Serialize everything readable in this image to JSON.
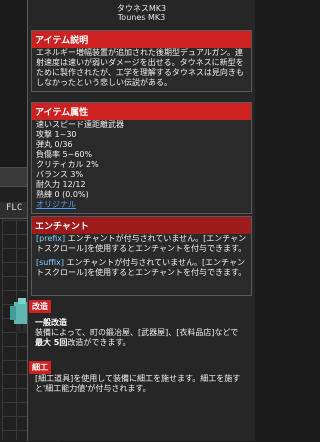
{
  "header": {
    "name_jp": "タウネスMK3",
    "name_en": "Tounes MK3"
  },
  "sections": {
    "description": {
      "title": "アイテム説明",
      "text": "エネルギー増幅装置が追加された後期型デュアルガン。連射速度は速いが弱いダメージを出せる。タウネスに新型をために製作されたが、工学を理解するタウネスは見向きもしなかったという悲しい伝説がある。"
    },
    "attributes": {
      "title": "アイテム属性",
      "rows": [
        "速いスピード遠距離武器",
        "攻撃 1~30",
        "弾丸 0/36",
        "負傷率 5~60%",
        "クリティカル 2%",
        "バランス 3%",
        "耐久力 12/12",
        "熟練 0 (0.0%)"
      ],
      "original": "オリジナル"
    },
    "enchant": {
      "title": "エンチャント",
      "prefix_label": "[prefix]",
      "prefix_text": "エンチャントが付与されていません。[エンチャントスクロール]を使用するとエンチャントを付与できます。",
      "suffix_label": "[suffix]",
      "suffix_text": "エンチャントが付与されていません。[エンチャントスクロール]を使用するとエンチャントを付与できます。"
    },
    "modification": {
      "title": "改造",
      "subtitle": "一般改造",
      "text_before": "装備によって、町の鍛冶屋、[武器屋]、[衣料品店]などで",
      "text_bold": "最大 5回",
      "text_after": "改造ができます。"
    },
    "detail": {
      "title": "細工",
      "text": "[細工道具]を使用して装備に細工を施せます。細工を施すと'細工能力値'が付与されます。"
    }
  },
  "bg_window": {
    "tab_label": "FLC",
    "arrow": "▶",
    "close_glyph": "✕"
  },
  "colors": {
    "header_red": "#cc2222",
    "link_blue": "#4aa0ff",
    "enchant_cyan": "#7ed0ff"
  }
}
